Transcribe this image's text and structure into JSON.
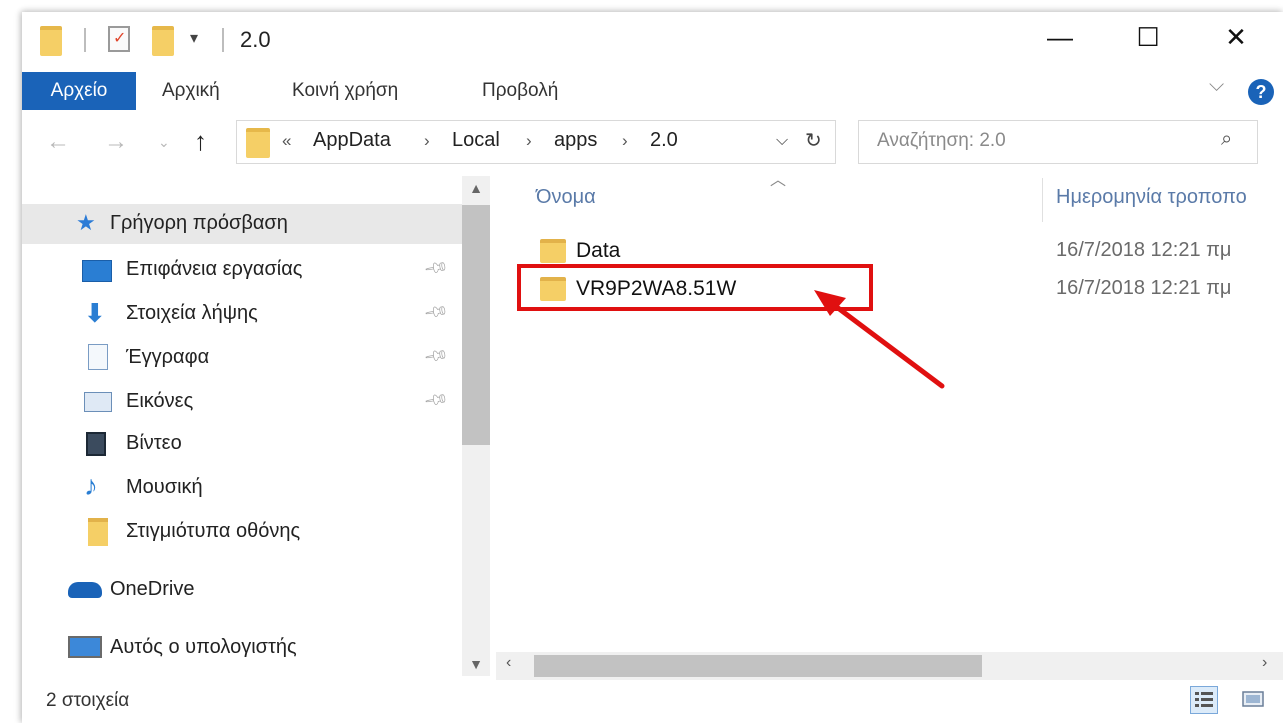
{
  "title_bar": {
    "title": "2.0",
    "minimize": "—",
    "maximize": "☐",
    "close": "✕",
    "dropdown": "▾"
  },
  "ribbon": {
    "file_tab": "Αρχείο",
    "tabs": [
      "Αρχική",
      "Κοινή χρήση",
      "Προβολή"
    ],
    "help": "?"
  },
  "address": {
    "overflow": "«",
    "crumbs": [
      "AppData",
      "Local",
      "apps",
      "2.0"
    ],
    "separator": "›",
    "search_placeholder": "Αναζήτηση: 2.0"
  },
  "navigation": {
    "items": [
      {
        "label": "Γρήγορη πρόσβαση",
        "icon": "star-icon",
        "pinned": false,
        "selected": true
      },
      {
        "label": "Επιφάνεια εργασίας",
        "icon": "desktop-icon",
        "pinned": true
      },
      {
        "label": "Στοιχεία λήψης",
        "icon": "download-icon",
        "pinned": true
      },
      {
        "label": "Έγγραφα",
        "icon": "documents-icon",
        "pinned": true
      },
      {
        "label": "Εικόνες",
        "icon": "pictures-icon",
        "pinned": true
      },
      {
        "label": "Βίντεο",
        "icon": "video-icon",
        "pinned": false
      },
      {
        "label": "Μουσική",
        "icon": "music-icon",
        "pinned": false
      },
      {
        "label": "Στιγμιότυπα οθόνης",
        "icon": "folder-icon",
        "pinned": false
      },
      {
        "label": "OneDrive",
        "icon": "cloud-icon",
        "pinned": false
      },
      {
        "label": "Αυτός ο υπολογιστής",
        "icon": "computer-icon",
        "pinned": false
      }
    ]
  },
  "content": {
    "columns": {
      "name": "Όνομα",
      "date": "Ημερομηνία τροποπο"
    },
    "files": [
      {
        "name": "Data",
        "date": "16/7/2018 12:21 πμ"
      },
      {
        "name": "VR9P2WA8.51W",
        "date": "16/7/2018 12:21 πμ"
      }
    ]
  },
  "status_bar": {
    "count": "2 στοιχεία"
  },
  "colors": {
    "accent": "#1a63b8",
    "folder": "#f5cf66",
    "highlight": "#e01010",
    "selected_nav": "#e8e8e8"
  }
}
